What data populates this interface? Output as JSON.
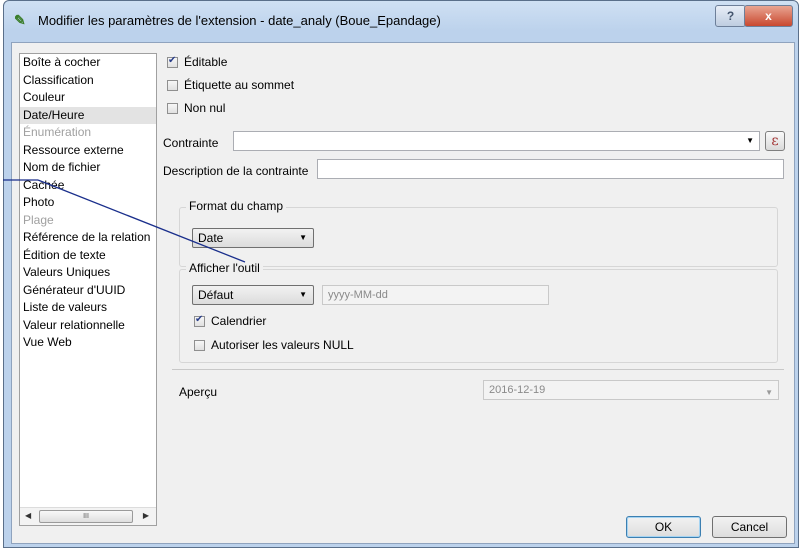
{
  "window": {
    "title": "Modifier les paramètres de l'extension - date_analy (Boue_Epandage)",
    "help_label": "?",
    "close_label": "x"
  },
  "widget_list": {
    "items": [
      {
        "label": "Boîte à cocher",
        "state": "normal"
      },
      {
        "label": "Classification",
        "state": "normal"
      },
      {
        "label": "Couleur",
        "state": "normal"
      },
      {
        "label": "Date/Heure",
        "state": "selected"
      },
      {
        "label": "Énumération",
        "state": "disabled"
      },
      {
        "label": "Ressource externe",
        "state": "normal"
      },
      {
        "label": "Nom de fichier",
        "state": "normal"
      },
      {
        "label": "Cachée",
        "state": "normal"
      },
      {
        "label": "Photo",
        "state": "normal"
      },
      {
        "label": "Plage",
        "state": "disabled"
      },
      {
        "label": "Référence de la relation",
        "state": "normal"
      },
      {
        "label": "Édition de texte",
        "state": "normal"
      },
      {
        "label": "Valeurs Uniques",
        "state": "normal"
      },
      {
        "label": "Générateur d'UUID",
        "state": "normal"
      },
      {
        "label": "Liste de valeurs",
        "state": "normal"
      },
      {
        "label": "Valeur relationnelle",
        "state": "normal"
      },
      {
        "label": "Vue Web",
        "state": "normal"
      }
    ],
    "scroll_thumb": "III"
  },
  "options": {
    "editable": {
      "label": "Éditable",
      "checked": true
    },
    "label_on_top": {
      "label": "Étiquette au sommet",
      "checked": false
    },
    "not_null": {
      "label": "Non nul",
      "checked": false
    }
  },
  "constraint": {
    "label": "Contrainte",
    "value": "",
    "expr_symbol": "ε"
  },
  "constraint_description": {
    "label": "Description de la contrainte",
    "value": ""
  },
  "field_format": {
    "group_title": "Format du champ",
    "value": "Date"
  },
  "display_tool": {
    "group_title": "Afficher l'outil",
    "format_value": "Défaut",
    "format_placeholder": "yyyy-MM-dd",
    "calendar": {
      "label": "Calendrier",
      "checked": true
    },
    "allow_null": {
      "label": "Autoriser les valeurs NULL",
      "checked": false
    }
  },
  "preview": {
    "label": "Aperçu",
    "value": "2016-12-19"
  },
  "buttons": {
    "ok": "OK",
    "cancel": "Cancel"
  }
}
